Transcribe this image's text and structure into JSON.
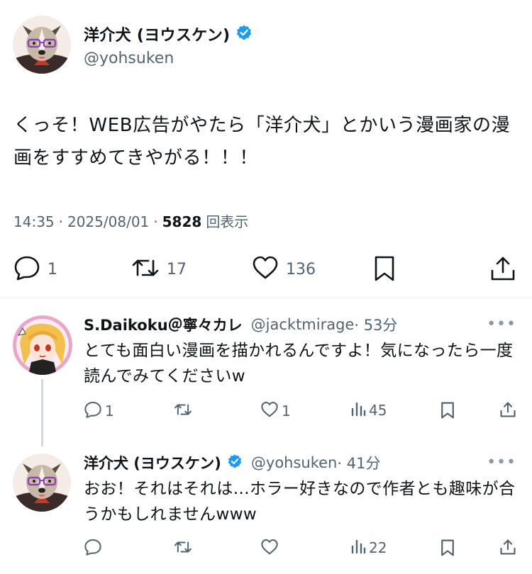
{
  "main_tweet": {
    "author_name": "洋介犬 (ヨウスケン)",
    "handle": "@yohsuken",
    "verified": true,
    "text": "くっそ！WEB広告がやたら「洋介犬」とかいう漫画家の漫画をすすめてきやがる！！！",
    "time": "14:35",
    "date": "2025/08/01",
    "separator": "·",
    "views": "5828",
    "views_label": "回表示",
    "replies": "1",
    "reposts": "17",
    "likes": "136",
    "icons": [
      "reply-icon",
      "retweet-icon",
      "heart-icon",
      "bookmark-icon",
      "share-icon",
      "verified-badge-icon"
    ]
  },
  "replies": [
    {
      "author_name": "S.Daikoku＠寧々カレ",
      "handle": "@jacktmirage",
      "time": "· 53分",
      "more": "•••",
      "text": "とても面白い漫画を描かれるんですよ！気になったら一度読んでみてくださいw",
      "replies": "1",
      "reposts": "",
      "likes": "1",
      "views": "45"
    },
    {
      "author_name": "洋介犬 (ヨウスケン)",
      "handle": "@yohsuken",
      "verified": true,
      "time": "· 41分",
      "more": "•••",
      "text": "おお！それはそれは…ホラー好きなので作者とも趣味が合うかもしれませんwww",
      "replies": "",
      "reposts": "",
      "likes": "",
      "views": "22"
    }
  ],
  "colors": {
    "text": "#0f1419",
    "secondary": "#536471",
    "verified": "#1d9bf0",
    "divider": "#eff3f4",
    "thread_line": "#cfd9de"
  }
}
